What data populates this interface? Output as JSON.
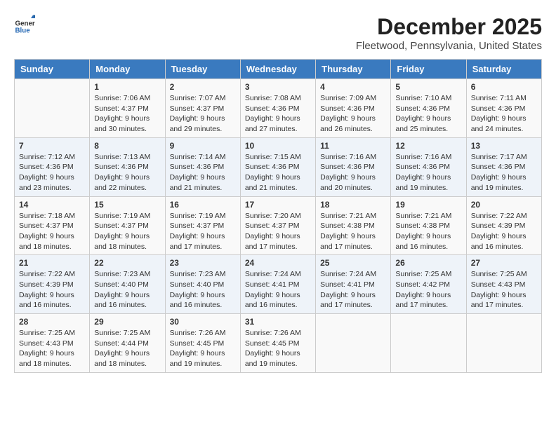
{
  "header": {
    "logo_general": "General",
    "logo_blue": "Blue",
    "title": "December 2025",
    "subtitle": "Fleetwood, Pennsylvania, United States"
  },
  "days_of_week": [
    "Sunday",
    "Monday",
    "Tuesday",
    "Wednesday",
    "Thursday",
    "Friday",
    "Saturday"
  ],
  "weeks": [
    [
      {
        "day": "",
        "info": ""
      },
      {
        "day": "1",
        "info": "Sunrise: 7:06 AM\nSunset: 4:37 PM\nDaylight: 9 hours\nand 30 minutes."
      },
      {
        "day": "2",
        "info": "Sunrise: 7:07 AM\nSunset: 4:37 PM\nDaylight: 9 hours\nand 29 minutes."
      },
      {
        "day": "3",
        "info": "Sunrise: 7:08 AM\nSunset: 4:36 PM\nDaylight: 9 hours\nand 27 minutes."
      },
      {
        "day": "4",
        "info": "Sunrise: 7:09 AM\nSunset: 4:36 PM\nDaylight: 9 hours\nand 26 minutes."
      },
      {
        "day": "5",
        "info": "Sunrise: 7:10 AM\nSunset: 4:36 PM\nDaylight: 9 hours\nand 25 minutes."
      },
      {
        "day": "6",
        "info": "Sunrise: 7:11 AM\nSunset: 4:36 PM\nDaylight: 9 hours\nand 24 minutes."
      }
    ],
    [
      {
        "day": "7",
        "info": "Sunrise: 7:12 AM\nSunset: 4:36 PM\nDaylight: 9 hours\nand 23 minutes."
      },
      {
        "day": "8",
        "info": "Sunrise: 7:13 AM\nSunset: 4:36 PM\nDaylight: 9 hours\nand 22 minutes."
      },
      {
        "day": "9",
        "info": "Sunrise: 7:14 AM\nSunset: 4:36 PM\nDaylight: 9 hours\nand 21 minutes."
      },
      {
        "day": "10",
        "info": "Sunrise: 7:15 AM\nSunset: 4:36 PM\nDaylight: 9 hours\nand 21 minutes."
      },
      {
        "day": "11",
        "info": "Sunrise: 7:16 AM\nSunset: 4:36 PM\nDaylight: 9 hours\nand 20 minutes."
      },
      {
        "day": "12",
        "info": "Sunrise: 7:16 AM\nSunset: 4:36 PM\nDaylight: 9 hours\nand 19 minutes."
      },
      {
        "day": "13",
        "info": "Sunrise: 7:17 AM\nSunset: 4:36 PM\nDaylight: 9 hours\nand 19 minutes."
      }
    ],
    [
      {
        "day": "14",
        "info": "Sunrise: 7:18 AM\nSunset: 4:37 PM\nDaylight: 9 hours\nand 18 minutes."
      },
      {
        "day": "15",
        "info": "Sunrise: 7:19 AM\nSunset: 4:37 PM\nDaylight: 9 hours\nand 18 minutes."
      },
      {
        "day": "16",
        "info": "Sunrise: 7:19 AM\nSunset: 4:37 PM\nDaylight: 9 hours\nand 17 minutes."
      },
      {
        "day": "17",
        "info": "Sunrise: 7:20 AM\nSunset: 4:37 PM\nDaylight: 9 hours\nand 17 minutes."
      },
      {
        "day": "18",
        "info": "Sunrise: 7:21 AM\nSunset: 4:38 PM\nDaylight: 9 hours\nand 17 minutes."
      },
      {
        "day": "19",
        "info": "Sunrise: 7:21 AM\nSunset: 4:38 PM\nDaylight: 9 hours\nand 16 minutes."
      },
      {
        "day": "20",
        "info": "Sunrise: 7:22 AM\nSunset: 4:39 PM\nDaylight: 9 hours\nand 16 minutes."
      }
    ],
    [
      {
        "day": "21",
        "info": "Sunrise: 7:22 AM\nSunset: 4:39 PM\nDaylight: 9 hours\nand 16 minutes."
      },
      {
        "day": "22",
        "info": "Sunrise: 7:23 AM\nSunset: 4:40 PM\nDaylight: 9 hours\nand 16 minutes."
      },
      {
        "day": "23",
        "info": "Sunrise: 7:23 AM\nSunset: 4:40 PM\nDaylight: 9 hours\nand 16 minutes."
      },
      {
        "day": "24",
        "info": "Sunrise: 7:24 AM\nSunset: 4:41 PM\nDaylight: 9 hours\nand 16 minutes."
      },
      {
        "day": "25",
        "info": "Sunrise: 7:24 AM\nSunset: 4:41 PM\nDaylight: 9 hours\nand 17 minutes."
      },
      {
        "day": "26",
        "info": "Sunrise: 7:25 AM\nSunset: 4:42 PM\nDaylight: 9 hours\nand 17 minutes."
      },
      {
        "day": "27",
        "info": "Sunrise: 7:25 AM\nSunset: 4:43 PM\nDaylight: 9 hours\nand 17 minutes."
      }
    ],
    [
      {
        "day": "28",
        "info": "Sunrise: 7:25 AM\nSunset: 4:43 PM\nDaylight: 9 hours\nand 18 minutes."
      },
      {
        "day": "29",
        "info": "Sunrise: 7:25 AM\nSunset: 4:44 PM\nDaylight: 9 hours\nand 18 minutes."
      },
      {
        "day": "30",
        "info": "Sunrise: 7:26 AM\nSunset: 4:45 PM\nDaylight: 9 hours\nand 19 minutes."
      },
      {
        "day": "31",
        "info": "Sunrise: 7:26 AM\nSunset: 4:45 PM\nDaylight: 9 hours\nand 19 minutes."
      },
      {
        "day": "",
        "info": ""
      },
      {
        "day": "",
        "info": ""
      },
      {
        "day": "",
        "info": ""
      }
    ]
  ]
}
